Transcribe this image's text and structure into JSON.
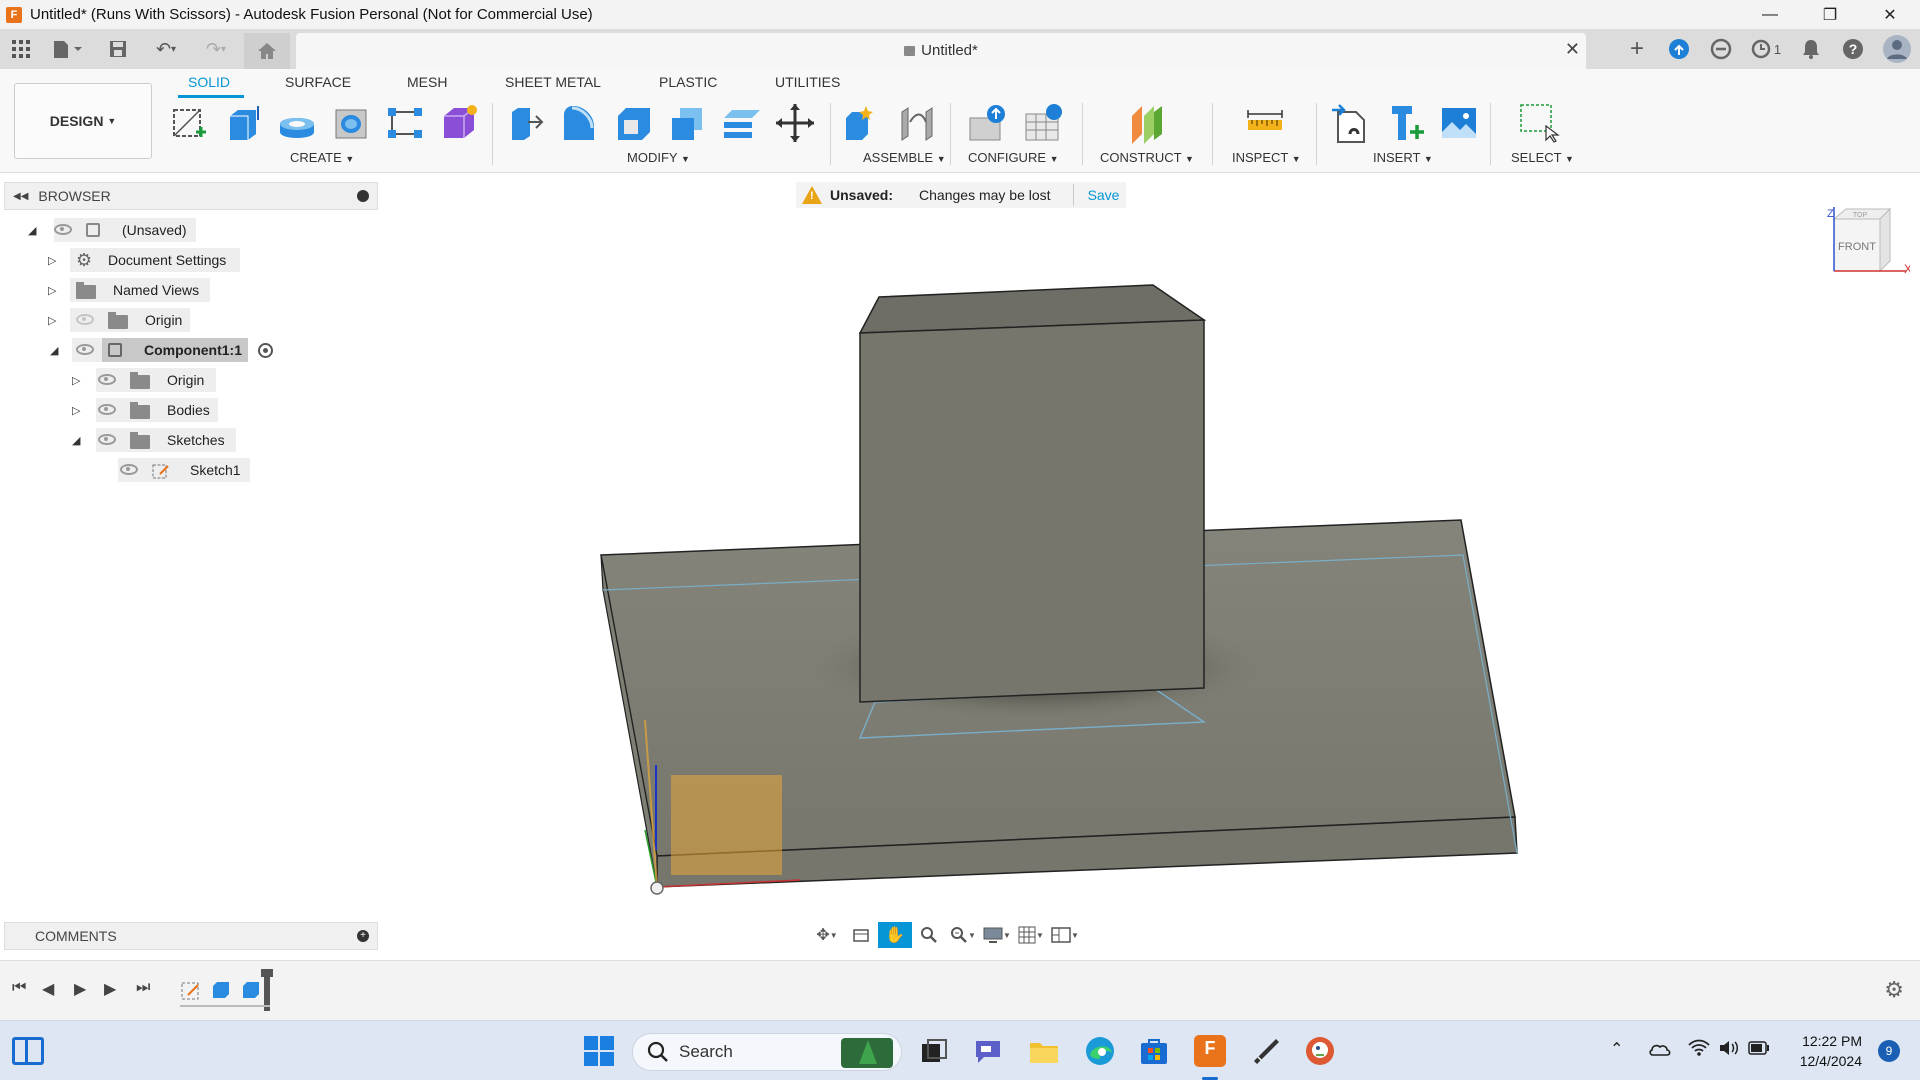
{
  "window": {
    "title": "Untitled* (Runs With Scissors) - Autodesk Fusion Personal (Not for Commercial Use)",
    "app_icon_letter": "F"
  },
  "document_tab": {
    "title": "Untitled*",
    "job_count": "1"
  },
  "ribbon": {
    "workspace": "DESIGN",
    "tabs": [
      "SOLID",
      "SURFACE",
      "MESH",
      "SHEET METAL",
      "PLASTIC",
      "UTILITIES"
    ],
    "active_tab": "SOLID",
    "groups": [
      "CREATE",
      "MODIFY",
      "ASSEMBLE",
      "CONFIGURE",
      "CONSTRUCT",
      "INSPECT",
      "INSERT",
      "SELECT"
    ]
  },
  "browser": {
    "title": "BROWSER",
    "items": [
      {
        "label": "(Unsaved)"
      },
      {
        "label": "Document Settings"
      },
      {
        "label": "Named Views"
      },
      {
        "label": "Origin"
      },
      {
        "label": "Component1:1"
      },
      {
        "label": "Origin"
      },
      {
        "label": "Bodies"
      },
      {
        "label": "Sketches"
      },
      {
        "label": "Sketch1"
      }
    ]
  },
  "unsaved_banner": {
    "title": "Unsaved:",
    "message": "Changes may be lost",
    "action": "Save"
  },
  "viewcube": {
    "front_label": "FRONT",
    "top_label": "TOP",
    "axis_x": "X",
    "axis_z": "Z"
  },
  "comments": {
    "title": "COMMENTS"
  },
  "taskbar": {
    "search_placeholder": "Search",
    "time": "12:22 PM",
    "date": "12/4/2024",
    "notification_count": "9"
  },
  "colors": {
    "accent": "#0696d7",
    "body_fill": "#7a7a70",
    "sketch_profile": "#e8a838"
  }
}
